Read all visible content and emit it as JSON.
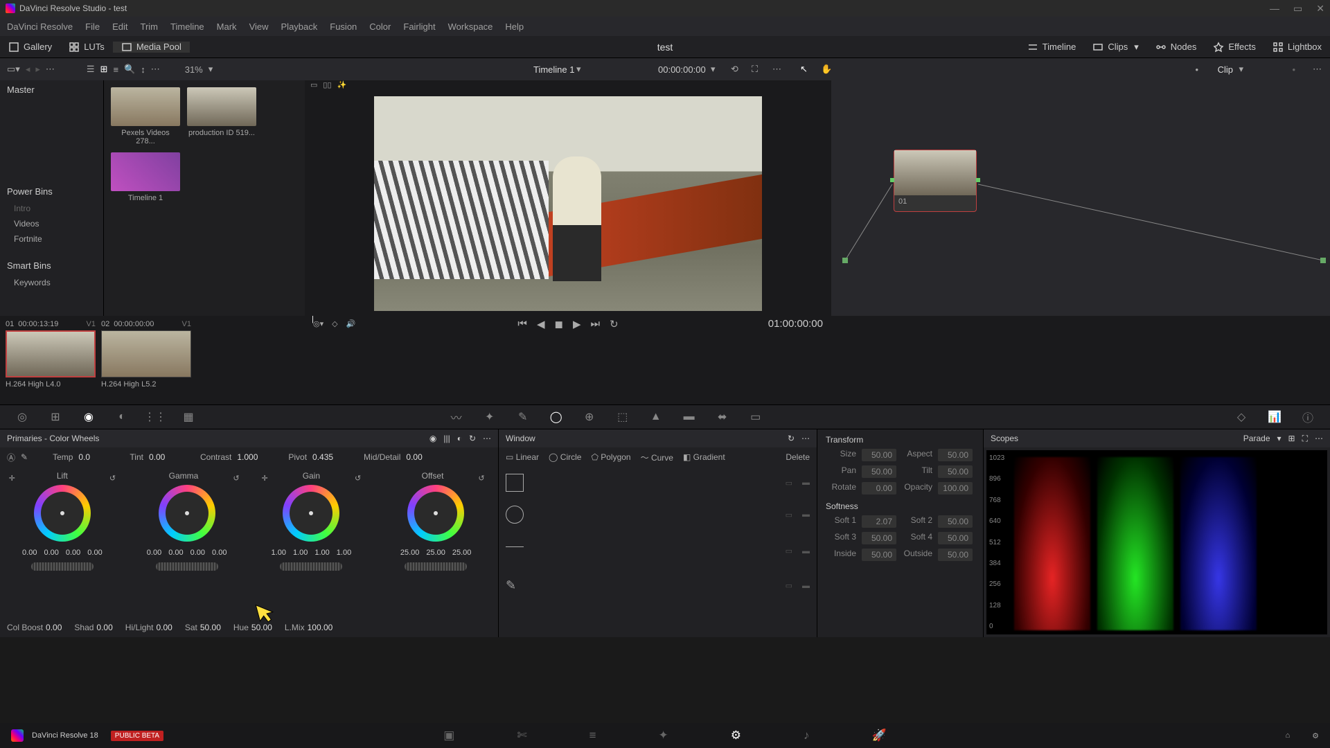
{
  "app": {
    "title": "DaVinci Resolve Studio - test",
    "footer_name": "DaVinci Resolve 18",
    "beta": "PUBLIC BETA"
  },
  "menu": [
    "DaVinci Resolve",
    "File",
    "Edit",
    "Trim",
    "Timeline",
    "Mark",
    "View",
    "Playback",
    "Fusion",
    "Color",
    "Fairlight",
    "Workspace",
    "Help"
  ],
  "toolbar": {
    "gallery": "Gallery",
    "luts": "LUTs",
    "mediapool": "Media Pool",
    "project": "test",
    "timeline": "Timeline",
    "clips": "Clips",
    "nodes": "Nodes",
    "effects": "Effects",
    "lightbox": "Lightbox"
  },
  "subtoolbar": {
    "zoom": "31%",
    "timeline_name": "Timeline 1",
    "tc": "00:00:00:00",
    "clip_label": "Clip"
  },
  "bins": {
    "master": "Master",
    "powerbins": "Power Bins",
    "power_items": [
      "Intro",
      "Videos",
      "Fortnite"
    ],
    "smartbins": "Smart Bins",
    "smart_items": [
      "Keywords"
    ]
  },
  "thumbs": [
    {
      "name": "Pexels Videos 278..."
    },
    {
      "name": "production ID 519..."
    },
    {
      "name": "Timeline 1"
    }
  ],
  "viewer": {
    "tc_right": "01:00:00:00"
  },
  "nodes": {
    "node1": "01"
  },
  "clips": [
    {
      "idx": "01",
      "tc": "00:00:13:19",
      "vt": "V1",
      "codec": "H.264 High L4.0",
      "selected": true
    },
    {
      "idx": "02",
      "tc": "00:00:00:00",
      "vt": "V1",
      "codec": "H.264 High L5.2",
      "selected": false
    }
  ],
  "primaries": {
    "title": "Primaries - Color Wheels",
    "temp_l": "Temp",
    "temp_v": "0.0",
    "tint_l": "Tint",
    "tint_v": "0.00",
    "contrast_l": "Contrast",
    "contrast_v": "1.000",
    "pivot_l": "Pivot",
    "pivot_v": "0.435",
    "md_l": "Mid/Detail",
    "md_v": "0.00",
    "wheels": [
      {
        "name": "Lift",
        "vals": [
          "0.00",
          "0.00",
          "0.00",
          "0.00"
        ]
      },
      {
        "name": "Gamma",
        "vals": [
          "0.00",
          "0.00",
          "0.00",
          "0.00"
        ]
      },
      {
        "name": "Gain",
        "vals": [
          "1.00",
          "1.00",
          "1.00",
          "1.00"
        ]
      },
      {
        "name": "Offset",
        "vals": [
          "25.00",
          "25.00",
          "25.00"
        ]
      }
    ],
    "row2": {
      "colboost_l": "Col Boost",
      "colboost_v": "0.00",
      "shad_l": "Shad",
      "shad_v": "0.00",
      "hilight_l": "Hi/Light",
      "hilight_v": "0.00",
      "sat_l": "Sat",
      "sat_v": "50.00",
      "hue_l": "Hue",
      "hue_v": "50.00",
      "lmix_l": "L.Mix",
      "lmix_v": "100.00"
    }
  },
  "window": {
    "title": "Window",
    "linear": "Linear",
    "circle": "Circle",
    "polygon": "Polygon",
    "curve": "Curve",
    "gradient": "Gradient",
    "delete": "Delete"
  },
  "transform": {
    "title": "Transform",
    "size_l": "Size",
    "size_v": "50.00",
    "aspect_l": "Aspect",
    "aspect_v": "50.00",
    "pan_l": "Pan",
    "pan_v": "50.00",
    "tilt_l": "Tilt",
    "tilt_v": "50.00",
    "rotate_l": "Rotate",
    "rotate_v": "0.00",
    "opacity_l": "Opacity",
    "opacity_v": "100.00",
    "softness": "Softness",
    "s1_l": "Soft 1",
    "s1_v": "2.07",
    "s2_l": "Soft 2",
    "s2_v": "50.00",
    "s3_l": "Soft 3",
    "s3_v": "50.00",
    "s4_l": "Soft 4",
    "s4_v": "50.00",
    "inside_l": "Inside",
    "inside_v": "50.00",
    "outside_l": "Outside",
    "outside_v": "50.00"
  },
  "scopes": {
    "title": "Scopes",
    "mode": "Parade",
    "axis": [
      "1023",
      "896",
      "768",
      "640",
      "512",
      "384",
      "256",
      "128",
      "0"
    ]
  }
}
